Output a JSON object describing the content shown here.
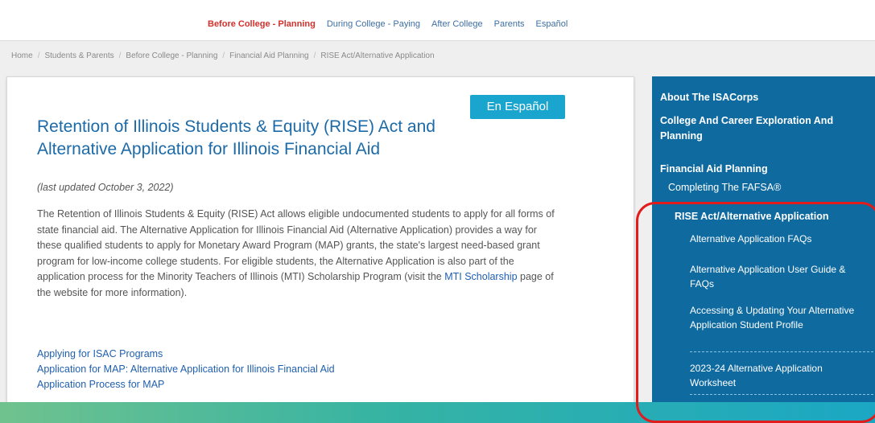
{
  "top_nav": {
    "items": [
      {
        "label": "Before College - Planning",
        "active": true
      },
      {
        "label": "During College - Paying"
      },
      {
        "label": "After College"
      },
      {
        "label": "Parents"
      },
      {
        "label": "Español"
      }
    ]
  },
  "breadcrumb": [
    "Home",
    "Students & Parents",
    "Before College - Planning",
    "Financial Aid Planning",
    "RISE Act/Alternative Application"
  ],
  "main": {
    "espanol_button": "En Español",
    "title": "Retention of Illinois Students & Equity (RISE) Act and Alternative Application for Illinois Financial Aid",
    "updated": "(last updated October 3, 2022)",
    "paragraph_start": "The Retention of Illinois Students & Equity (RISE) Act allows eligible undocumented students to apply for all forms of state financial aid. The Alternative Application for Illinois Financial Aid (Alternative Application) provides a way for these qualified students to apply for Monetary Award Program (MAP) grants, the state's largest need-based grant program for low-income college students. For eligible students, the Alternative Application is also part of the application process for the Minority Teachers of Illinois (MTI) Scholarship Program (visit the ",
    "paragraph_link": "MTI Scholarship",
    "paragraph_end": " page of the website for more information).",
    "links": [
      "Applying for ISAC Programs",
      "Application for MAP: Alternative Application for Illinois Financial Aid",
      "Application Process for MAP"
    ]
  },
  "sidebar": {
    "about": "About The ISACorps",
    "exploration": "College And Career Exploration And Planning",
    "financial_aid": "Financial Aid Planning",
    "fafsa": "Completing The FAFSA®",
    "rise": "RISE Act/Alternative Application",
    "sub_items": [
      "Alternative Application FAQs",
      "Alternative Application User Guide & FAQs",
      "Accessing & Updating Your Alternative Application Student Profile",
      "2023-24 Alternative Application Worksheet"
    ]
  },
  "colors": {
    "accent_blue": "#1c6aa7",
    "sidebar_bg": "#0f6aa0",
    "active_nav": "#d3302b",
    "highlight_outline": "#e21b1b"
  }
}
